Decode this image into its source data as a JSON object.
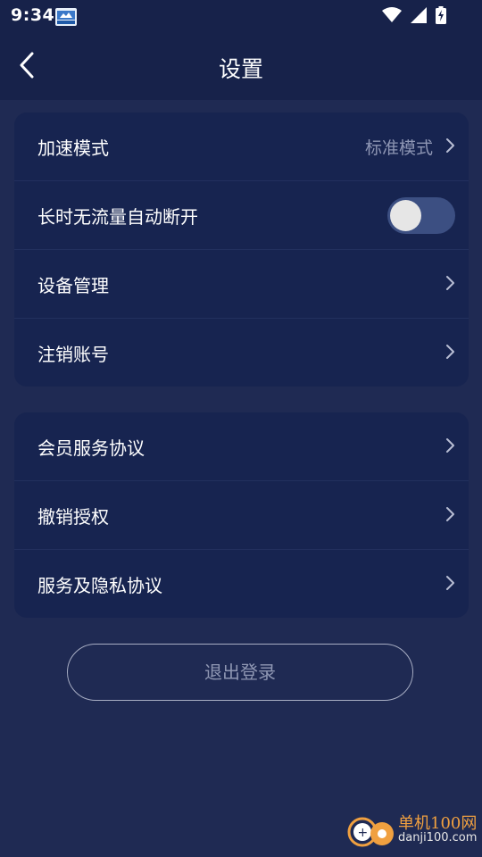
{
  "status_bar": {
    "time": "9:34",
    "icons": [
      "app-notification-icon",
      "wifi-icon",
      "signal-icon",
      "battery-charging-icon"
    ]
  },
  "app_bar": {
    "title": "设置",
    "back_icon": "back-chevron-icon"
  },
  "settings_group_1": [
    {
      "label": "加速模式",
      "value": "标准模式",
      "type": "link"
    },
    {
      "label": "长时无流量自动断开",
      "type": "toggle",
      "enabled": false
    },
    {
      "label": "设备管理",
      "type": "link"
    },
    {
      "label": "注销账号",
      "type": "link"
    }
  ],
  "settings_group_2": [
    {
      "label": "会员服务协议",
      "type": "link"
    },
    {
      "label": "撤销授权",
      "type": "link"
    },
    {
      "label": "服务及隐私协议",
      "type": "link"
    }
  ],
  "logout_button": "退出登录",
  "watermark": {
    "line1": "单机100网",
    "line2": "danji100.com"
  },
  "colors": {
    "background": "#1f2a53",
    "card": "#172450",
    "header": "#17224a",
    "toggle_track": "#3c4f82",
    "secondary_text": "#8e96b4",
    "watermark_orange": "#f0a040"
  }
}
